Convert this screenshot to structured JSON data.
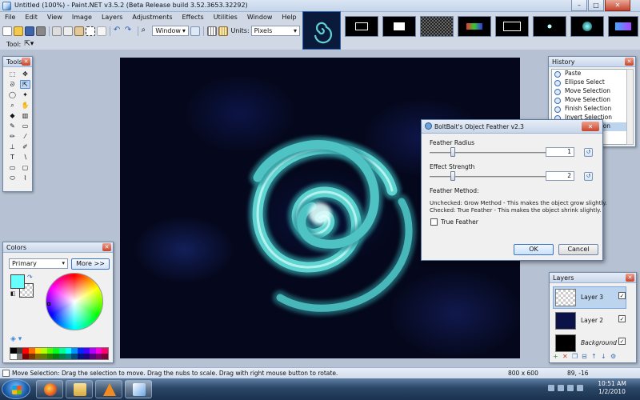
{
  "window": {
    "title": "Untitled (100%) - Paint.NET v3.5.2 (Beta Release build 3.52.3653.32292)",
    "minimize": "–",
    "maximize": "□",
    "close": "✕"
  },
  "menu": [
    "File",
    "Edit",
    "View",
    "Image",
    "Layers",
    "Adjustments",
    "Effects",
    "Utilities",
    "Window",
    "Help"
  ],
  "toolbar": {
    "zoom_mode": "Window",
    "units_label": "Units:",
    "units_value": "Pixels",
    "tool_label": "Tool:"
  },
  "tools_panel": {
    "title": "Tools",
    "tools": [
      {
        "name": "rectangle-select",
        "glyph": "⬚"
      },
      {
        "name": "move-selected",
        "glyph": "✥"
      },
      {
        "name": "lasso-select",
        "glyph": "ᘐ"
      },
      {
        "name": "move-selection",
        "glyph": "⇱"
      },
      {
        "name": "ellipse-select",
        "glyph": "◯"
      },
      {
        "name": "magic-wand",
        "glyph": "✦"
      },
      {
        "name": "zoom",
        "glyph": "⌕"
      },
      {
        "name": "pan",
        "glyph": "✋"
      },
      {
        "name": "paint-bucket",
        "glyph": "◆"
      },
      {
        "name": "gradient",
        "glyph": "▥"
      },
      {
        "name": "paintbrush",
        "glyph": "✎"
      },
      {
        "name": "eraser",
        "glyph": "▭"
      },
      {
        "name": "pencil",
        "glyph": "✏"
      },
      {
        "name": "color-picker",
        "glyph": "⁄"
      },
      {
        "name": "clone-stamp",
        "glyph": "⊥"
      },
      {
        "name": "recolor",
        "glyph": "✐"
      },
      {
        "name": "text",
        "glyph": "T"
      },
      {
        "name": "line-curve",
        "glyph": "∖"
      },
      {
        "name": "rectangle",
        "glyph": "▭"
      },
      {
        "name": "rounded-rectangle",
        "glyph": "▢"
      },
      {
        "name": "ellipse",
        "glyph": "⬭"
      },
      {
        "name": "freeform-shape",
        "glyph": "⌇"
      }
    ]
  },
  "colors_panel": {
    "title": "Colors",
    "mode": "Primary",
    "more_button": "More >>",
    "primary_color": "#66fffe",
    "palette": [
      "#000000",
      "#404040",
      "#ff0000",
      "#ff6a00",
      "#ffd800",
      "#b6ff00",
      "#4cff00",
      "#00ff21",
      "#00ff90",
      "#00ffff",
      "#0094ff",
      "#0026ff",
      "#4800ff",
      "#b200ff",
      "#ff00dc",
      "#ff006e",
      "#ffffff",
      "#808080",
      "#7f0000",
      "#7f3300",
      "#7f6a00",
      "#5b7f00",
      "#267f00",
      "#007f0e",
      "#007f46",
      "#007f7f",
      "#004a7f",
      "#00137f",
      "#21007f",
      "#57007f",
      "#7f006e",
      "#7f0037"
    ]
  },
  "history_panel": {
    "title": "History",
    "items": [
      "Paste",
      "Ellipse Select",
      "Move Selection",
      "Move Selection",
      "Finish Selection",
      "Invert Selection",
      "Move Selection"
    ]
  },
  "layers_panel": {
    "title": "Layers",
    "layers": [
      "Layer 3",
      "Layer 2",
      "Background"
    ]
  },
  "dialog": {
    "title": "BoltBait's Object Feather v2.3",
    "feather_radius_label": "Feather Radius",
    "feather_radius_value": "1",
    "feather_radius_fraction": 0.17,
    "effect_strength_label": "Effect Strength",
    "effect_strength_value": "2",
    "effect_strength_fraction": 0.17,
    "method_label": "Feather Method:",
    "unchecked_text": "Unchecked: Grow Method - This makes the object grow slightly.",
    "checked_text": "Checked: True Feather - This makes the object shrink slightly.",
    "true_feather_label": "True Feather",
    "ok": "OK",
    "cancel": "Cancel",
    "close": "✕"
  },
  "status": {
    "message": "Move Selection: Drag the selection to move. Drag the nubs to scale. Drag with right mouse button to rotate.",
    "image_size": "800 x 600",
    "cursor": "89, -16"
  },
  "taskbar": {
    "time": "10:51 AM",
    "date": "1/2/2010"
  },
  "colors": {
    "spiral": "#5fd3cf",
    "canvas_bg": "#05081c"
  }
}
